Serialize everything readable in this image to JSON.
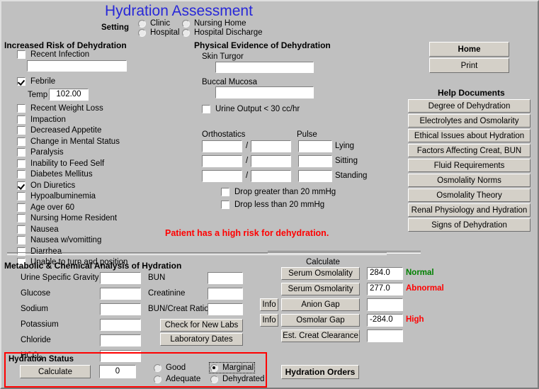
{
  "window": {
    "title": "Hydration Assessment"
  },
  "setting": {
    "label": "Setting",
    "options": [
      {
        "label": "Clinic",
        "selected": false
      },
      {
        "label": "Nursing Home",
        "selected": false
      },
      {
        "label": "Hospital",
        "selected": false
      },
      {
        "label": "Hospital Discharge",
        "selected": false
      }
    ]
  },
  "risk": {
    "heading": "Increased Risk of Dehydration",
    "recent_infection": {
      "label": "Recent Infection",
      "checked": false,
      "value": ""
    },
    "febrile": {
      "label": "Febrile",
      "checked": true
    },
    "temp": {
      "label": "Temp",
      "value": "102.00"
    },
    "items": [
      {
        "label": "Recent Weight Loss",
        "checked": false
      },
      {
        "label": "Impaction",
        "checked": false
      },
      {
        "label": "Decreased Appetite",
        "checked": false
      },
      {
        "label": "Change in Mental Status",
        "checked": false
      },
      {
        "label": "Paralysis",
        "checked": false
      },
      {
        "label": "Inability to Feed Self",
        "checked": false
      },
      {
        "label": "Diabetes Mellitus",
        "checked": false
      },
      {
        "label": "On Diuretics",
        "checked": true
      },
      {
        "label": "Hypoalbuminemia",
        "checked": false
      },
      {
        "label": "Age over 60",
        "checked": false
      },
      {
        "label": "Nursing Home Resident",
        "checked": false
      },
      {
        "label": "Nausea",
        "checked": false
      },
      {
        "label": "Nausea w/vomitting",
        "checked": false
      },
      {
        "label": "Diarrhea",
        "checked": false
      },
      {
        "label": "Unable to turn and position",
        "checked": false
      }
    ]
  },
  "physical": {
    "heading": "Physical Evidence of Dehydration",
    "skin_turgor": {
      "label": "Skin Turgor",
      "value": ""
    },
    "buccal_mucosa": {
      "label": "Buccal Mucosa",
      "value": ""
    },
    "urine_output": {
      "label": "Urine Output < 30 cc/hr",
      "checked": false
    },
    "orthostatics_label": "Orthostatics",
    "pulse_label": "Pulse",
    "rows": [
      {
        "position": "Lying",
        "systolic": "",
        "diastolic": "",
        "pulse": ""
      },
      {
        "position": "Sitting",
        "systolic": "",
        "diastolic": "",
        "pulse": ""
      },
      {
        "position": "Standing",
        "systolic": "",
        "diastolic": "",
        "pulse": ""
      }
    ],
    "separator": "/",
    "drop_greater": {
      "label": "Drop greater than 20 mmHg",
      "checked": false
    },
    "drop_less": {
      "label": "Drop less than 20 mmHg",
      "checked": false
    }
  },
  "alert": {
    "text": "Patient has a high risk for dehydration."
  },
  "actions": {
    "home": "Home",
    "print": "Print",
    "help_heading": "Help Documents",
    "help_buttons": [
      "Degree of Dehydration",
      "Electrolytes and Osmolarity",
      "Ethical Issues about Hydration",
      "Factors Affecting Creat, BUN",
      "Fluid Requirements",
      "Osmolality Norms",
      "Osmolality Theory",
      "Renal Physiology and Hydration",
      "Signs of Dehydration"
    ]
  },
  "metabolic": {
    "heading": "Metabolic & Chemical Analysis of Hydration",
    "left_fields": [
      {
        "label": "Urine Specific Gravity",
        "value": ""
      },
      {
        "label": "Glucose",
        "value": ""
      },
      {
        "label": "Sodium",
        "value": ""
      },
      {
        "label": "Potassium",
        "value": ""
      },
      {
        "label": "Chloride",
        "value": ""
      },
      {
        "label": "HCO",
        "subscript": "3",
        "value": ""
      }
    ],
    "right_fields": [
      {
        "label": "BUN",
        "value": ""
      },
      {
        "label": "Creatinine",
        "value": ""
      },
      {
        "label": "BUN/Creat Ratio",
        "value": ""
      }
    ],
    "check_new_labs": "Check for New Labs",
    "laboratory_dates": "Laboratory Dates"
  },
  "calculate": {
    "heading": "Calculate",
    "info_label": "Info",
    "rows": [
      {
        "button": "Serum Osmolality",
        "value": "284.0",
        "status": "Normal",
        "status_color": "#008000",
        "info": false
      },
      {
        "button": "Serum Osmolarity",
        "value": "277.0",
        "status": "Abnormal",
        "status_color": "#ff0000",
        "info": false
      },
      {
        "button": "Anion Gap",
        "value": "",
        "status": "",
        "status_color": "#ff0000",
        "info": true
      },
      {
        "button": "Osmolar Gap",
        "value": "-284.0",
        "status": "High",
        "status_color": "#ff0000",
        "info": true
      },
      {
        "button": "Est. Creat Clearance",
        "value": "",
        "status": "",
        "status_color": "#ff0000",
        "info": false
      }
    ]
  },
  "status": {
    "heading": "Hydration Status",
    "calculate_button": "Calculate",
    "score": "0",
    "options": [
      {
        "label": "Good",
        "selected": false
      },
      {
        "label": "Marginal",
        "selected": true
      },
      {
        "label": "Adequate",
        "selected": false
      },
      {
        "label": "Dehydrated",
        "selected": false
      }
    ],
    "orders_button": "Hydration Orders"
  }
}
